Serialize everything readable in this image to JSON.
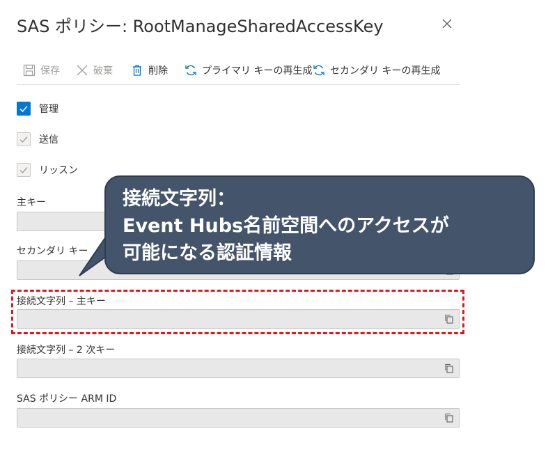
{
  "panel": {
    "title": "SAS ポリシー: RootManageSharedAccessKey"
  },
  "toolbar": {
    "save_label": "保存",
    "discard_label": "破棄",
    "delete_label": "削除",
    "regen_primary_label": "プライマリ キーの再生成",
    "regen_secondary_label": "セカンダリ キーの再生成"
  },
  "claims": [
    {
      "label": "管理",
      "checked": true,
      "disabled": false
    },
    {
      "label": "送信",
      "checked": true,
      "disabled": true
    },
    {
      "label": "リッスン",
      "checked": true,
      "disabled": true
    }
  ],
  "fields": {
    "primary_key_label": "主キー",
    "secondary_key_label": "セカンダリ キー",
    "conn_primary_label": "接続文字列 – 主キー",
    "conn_secondary_label": "接続文字列 – 2 次キー",
    "arm_id_label": "SAS ポリシー ARM ID"
  },
  "callout": {
    "line1": "接続文字列：",
    "line2": "Event Hubs名前空間へのアクセスが",
    "line3": "可能になる認証情報"
  },
  "colors": {
    "accent": "#0078d4",
    "callout_bg": "#44546a",
    "highlight": "#e8141e",
    "field_bg": "#e8e8e8"
  },
  "icons": {
    "close": "close-icon",
    "save": "save-icon",
    "discard": "discard-icon",
    "delete": "trash-icon",
    "regen": "refresh-icon",
    "copy": "copy-icon"
  }
}
